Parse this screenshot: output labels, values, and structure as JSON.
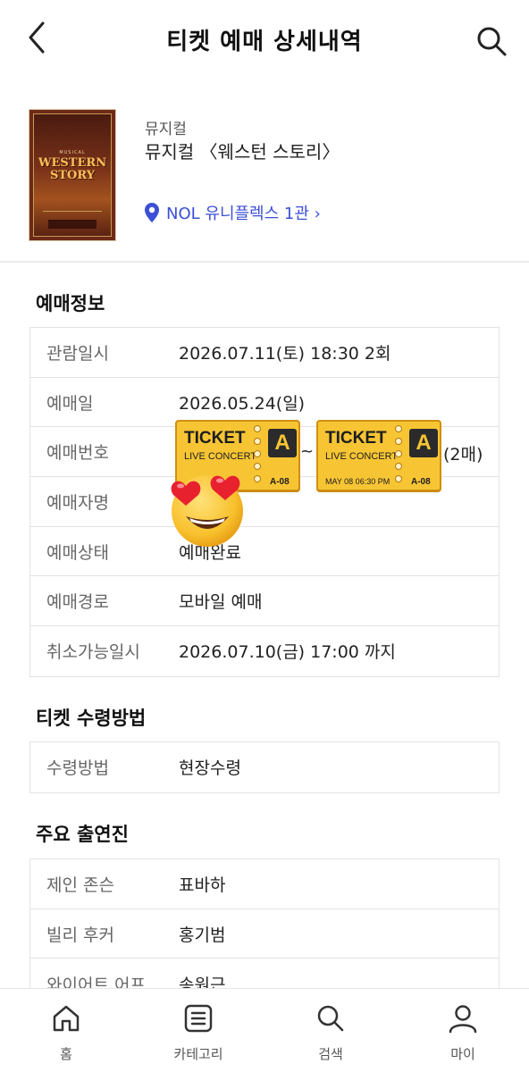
{
  "header": {
    "title": "티켓 예매 상세내역",
    "back_icon": "chevron-left-icon",
    "search_icon": "search-icon"
  },
  "show": {
    "poster": {
      "small_text": "MUSICAL",
      "title_line1": "WESTERN",
      "title_line2": "STORY"
    },
    "genre": "뮤지컬",
    "title": "뮤지컬 〈웨스턴 스토리〉",
    "venue": "NOL 유니플렉스 1관 ›",
    "venue_icon": "location-pin-icon",
    "accent_color": "#3b4fd6"
  },
  "booking_info": {
    "title": "예매정보",
    "rows": [
      {
        "label": "관람일시",
        "value": "2026.07.11(토) 18:30 2회"
      },
      {
        "label": "예매일",
        "value": "2026.05.24(일)"
      },
      {
        "label": "예매번호",
        "value": ""
      },
      {
        "label": "예매자명",
        "value": ""
      },
      {
        "label": "예매상태",
        "value": "예매완료"
      },
      {
        "label": "예매경로",
        "value": "모바일 예매"
      },
      {
        "label": "취소가능일시",
        "value": "2026.07.10(금) 17:00 까지"
      }
    ],
    "ticket_sticker": {
      "word": "TICKET",
      "subtitle": "LIVE CONCERT",
      "date": "MAY 08 06:30 PM",
      "letter": "A",
      "seat": "A-08",
      "separator": "~",
      "count": "(2매)"
    }
  },
  "pickup": {
    "title": "티켓 수령방법",
    "rows": [
      {
        "label": "수령방법",
        "value": "현장수령"
      }
    ]
  },
  "cast": {
    "title": "주요 출연진",
    "rows": [
      {
        "label": "제인 존슨",
        "value": "표바하"
      },
      {
        "label": "빌리 후커",
        "value": "홍기범"
      },
      {
        "label": "와이어트 어프",
        "value": "송원근"
      }
    ]
  },
  "bottom_nav": {
    "items": [
      {
        "label": "홈",
        "icon": "home-icon"
      },
      {
        "label": "카테고리",
        "icon": "category-list-icon"
      },
      {
        "label": "검색",
        "icon": "search-icon"
      },
      {
        "label": "마이",
        "icon": "person-icon"
      }
    ]
  }
}
